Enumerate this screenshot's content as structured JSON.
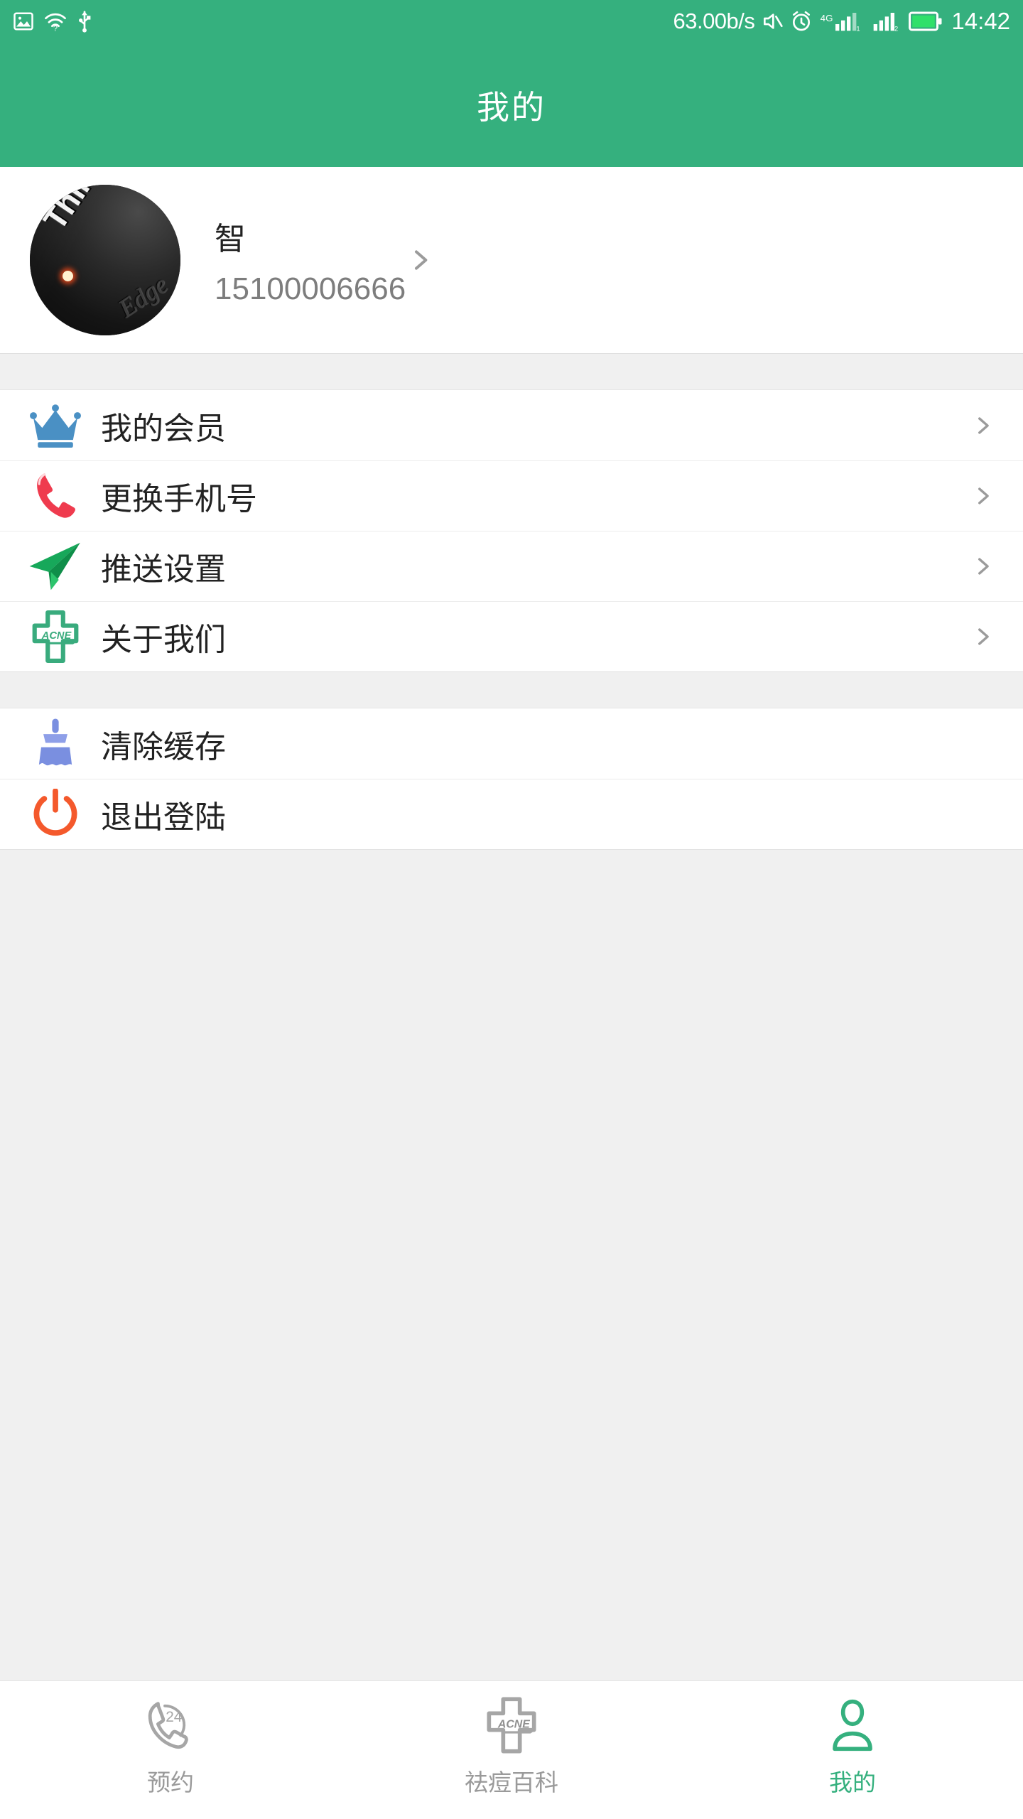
{
  "theme": {
    "primary": "#35b07e",
    "page_bg": "#f0f0f0",
    "card_bg": "#ffffff",
    "text": "#222222",
    "muted": "#7d7d7d",
    "tab_inactive": "#9a9a9a"
  },
  "statusbar": {
    "network_speed": "63.00b/s",
    "time": "14:42",
    "left_icons": [
      "image-icon",
      "wifi-question-icon",
      "usb-icon"
    ],
    "right_icons": [
      "mute-icon",
      "alarm-icon",
      "signal-4g-icon",
      "signal-2-icon",
      "battery-icon"
    ],
    "signal_label": "4G",
    "sim1_label": "1",
    "sim2_label": "2"
  },
  "header": {
    "title": "我的"
  },
  "profile": {
    "avatar_icon": "thinkpad-edge-avatar",
    "avatar_brand": "ThinkPad",
    "avatar_sub": "Edge",
    "name": "智",
    "phone": "15100006666",
    "chevron_icon": "chevron-right-icon"
  },
  "menu_groups": [
    {
      "items": [
        {
          "icon": "crown-icon",
          "icon_color": "#4a90c4",
          "label": "我的会员",
          "chevron": "chevron-right-icon"
        },
        {
          "icon": "phone-icon",
          "icon_color": "#ef3b4e",
          "label": "更换手机号",
          "chevron": "chevron-right-icon"
        },
        {
          "icon": "paper-plane-icon",
          "icon_color": "#17a85a",
          "label": "推送设置",
          "chevron": "chevron-right-icon"
        },
        {
          "icon": "acne-cross-icon",
          "icon_color": "#39ab7d",
          "label": "关于我们",
          "chevron": "chevron-right-icon"
        }
      ]
    },
    {
      "items": [
        {
          "icon": "broom-icon",
          "icon_color": "#7a8fe0",
          "label": "清除缓存",
          "chevron": null
        },
        {
          "icon": "power-icon",
          "icon_color": "#f4592c",
          "label": "退出登陆",
          "chevron": null
        }
      ]
    }
  ],
  "tabbar": {
    "tabs": [
      {
        "icon": "phone-24-icon",
        "label": "预约",
        "active": false
      },
      {
        "icon": "acne-cross-icon",
        "label": "祛痘百科",
        "active": false
      },
      {
        "icon": "person-icon",
        "label": "我的",
        "active": true
      }
    ]
  }
}
